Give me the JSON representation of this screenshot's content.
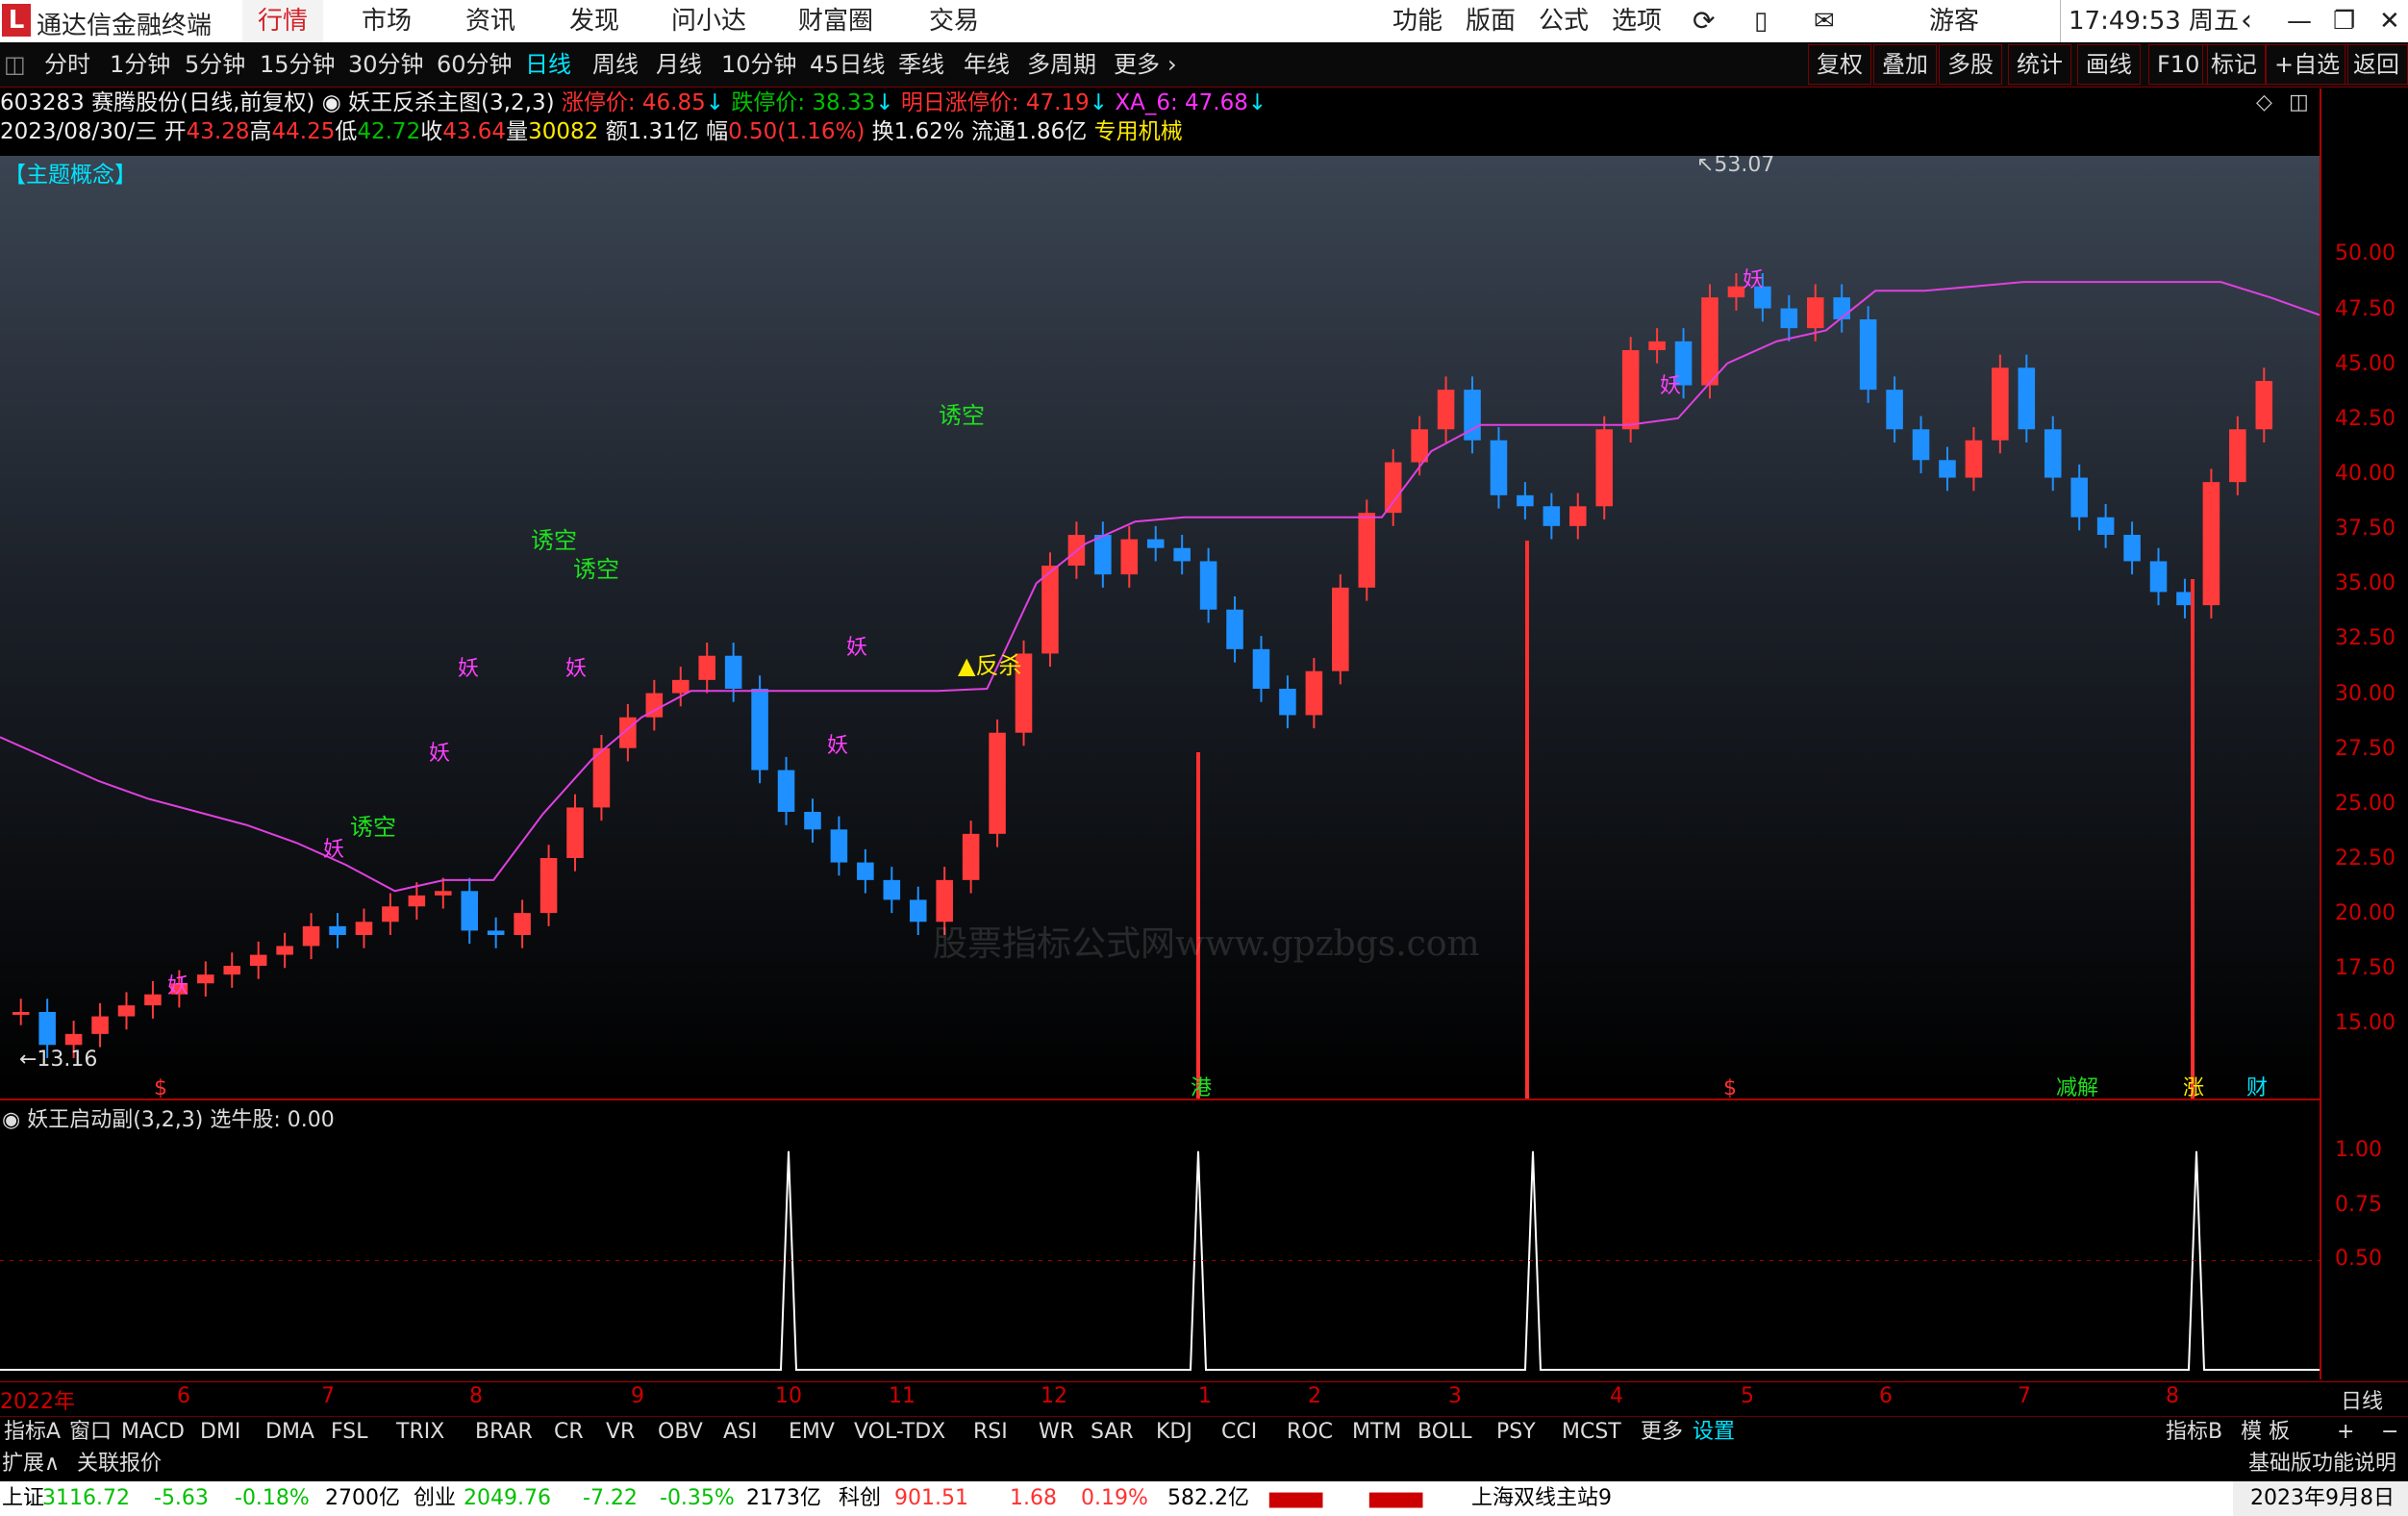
{
  "app": {
    "name": "通达信金融终端",
    "time": "17:49:53 周五",
    "user": "游客"
  },
  "topnav": {
    "items": [
      "行情",
      "市场",
      "资讯",
      "发现",
      "问小达",
      "财富圈",
      "交易"
    ],
    "right": [
      "功能",
      "版面",
      "公式",
      "选项"
    ]
  },
  "periods": {
    "items": [
      "分时",
      "1分钟",
      "5分钟",
      "15分钟",
      "30分钟",
      "60分钟",
      "日线",
      "周线",
      "月线",
      "10分钟",
      "45日线",
      "季线",
      "年线",
      "多周期",
      "更多"
    ],
    "selected": "日线"
  },
  "toolbar_right": [
    "复权",
    "叠加",
    "多股",
    "统计",
    "画线",
    "F10",
    "标记",
    "+自选",
    "返回"
  ],
  "stock": {
    "title": "603283 赛腾股份(日线,前复权)",
    "formula": "妖王反杀主图(3,2,3)",
    "zt": "涨停价: 46.85",
    "dt": "跌停价: 38.33",
    "mzt": "明日涨停价: 47.19",
    "xa": "XA_6: 47.68",
    "date": "2023/08/30/三",
    "open_l": "开",
    "open": "43.28",
    "high_l": "高",
    "high": "44.25",
    "low_l": "低",
    "low": "42.72",
    "close_l": "收",
    "close": "43.64",
    "vol_l": "量",
    "vol": "30082",
    "amt": "额1.31亿",
    "chg_l": "幅",
    "chg": "0.50(1.16%)",
    "turn": "换1.62%",
    "float": "流通1.86亿",
    "industry": "专用机械"
  },
  "chart_labels": {
    "theme": "【主题概念】",
    "max": "53.07",
    "min": "13.16",
    "youkong": "诱空",
    "yao": "妖",
    "fansha": "反杀",
    "watermark": "股票指标公式网www.gpzbgs.com",
    "mark_gang": "港",
    "mark_dollar": "$",
    "mark_jian": "减",
    "mark_jiejin": "解",
    "mark_zhang": "涨",
    "mark_cai": "财"
  },
  "sub_indicator": {
    "name": "妖王启动副(3,2,3)",
    "value": "选牛股: 0.00"
  },
  "chart_data": [
    {
      "type": "candlestick",
      "ylim": [
        12,
        54
      ],
      "y_ticks": [
        "50.00",
        "47.50",
        "45.00",
        "42.50",
        "40.00",
        "37.50",
        "35.00",
        "32.50",
        "30.00",
        "27.50",
        "25.00",
        "22.50",
        "20.00",
        "17.50",
        "15.00"
      ],
      "x_ticks": [
        "2022年",
        "6",
        "7",
        "8",
        "9",
        "10",
        "11",
        "12",
        "1",
        "2",
        "3",
        "4",
        "5",
        "6",
        "7",
        "8"
      ],
      "close": [
        15.5,
        14.0,
        14.5,
        15.3,
        15.8,
        16.3,
        16.8,
        17.2,
        17.6,
        18.1,
        18.5,
        19.4,
        19.0,
        19.6,
        20.3,
        20.8,
        21.0,
        19.2,
        19.0,
        20.0,
        22.5,
        24.8,
        27.5,
        28.9,
        30.0,
        30.6,
        31.7,
        30.2,
        26.5,
        24.6,
        23.8,
        22.3,
        21.5,
        20.6,
        19.6,
        21.5,
        23.6,
        28.2,
        31.8,
        35.8,
        37.2,
        35.4,
        37.0,
        36.6,
        36.0,
        33.8,
        32.0,
        30.2,
        29.0,
        31.0,
        34.8,
        38.2,
        40.5,
        42.0,
        43.8,
        41.5,
        39.0,
        38.5,
        37.6,
        38.5,
        42.0,
        45.6,
        46.0,
        44.0,
        48.0,
        48.5,
        47.5,
        46.6,
        48.0,
        47.0,
        43.8,
        42.0,
        40.6,
        39.8,
        41.5,
        44.8,
        42.0,
        39.8,
        38.0,
        37.2,
        36.0,
        34.6,
        34.0,
        39.6,
        42.0,
        44.2
      ],
      "ma_line": [
        28.0,
        27.0,
        26.0,
        25.2,
        24.6,
        24.0,
        23.2,
        22.2,
        21.0,
        21.5,
        21.5,
        24.5,
        27.0,
        28.9,
        30.1,
        30.1,
        30.1,
        30.1,
        30.1,
        30.1,
        30.2,
        35.0,
        36.8,
        37.8,
        38.0,
        38.0,
        38.0,
        38.0,
        38.0,
        41.0,
        42.2,
        42.2,
        42.2,
        42.2,
        42.5,
        45.0,
        46.0,
        46.5,
        48.3,
        48.3,
        48.5,
        48.7,
        48.7,
        48.7,
        48.7,
        48.7,
        48.0,
        47.2
      ],
      "max": 53.07,
      "min": 13.16
    },
    {
      "type": "line",
      "name": "选牛股",
      "ylim": [
        0,
        1.1
      ],
      "y_ticks": [
        "1.00",
        "0.75",
        "0.50"
      ],
      "spikes_at_months": [
        "10",
        "1",
        "3",
        "8"
      ],
      "values": [
        0,
        1,
        0,
        1,
        0,
        1,
        0,
        1,
        0
      ]
    }
  ],
  "indicator_tabs": {
    "items": [
      "指标A",
      "窗口",
      "MACD",
      "DMI",
      "DMA",
      "FSL",
      "TRIX",
      "BRAR",
      "CR",
      "VR",
      "OBV",
      "ASI",
      "EMV",
      "VOL-TDX",
      "RSI",
      "WR",
      "SAR",
      "KDJ",
      "CCI",
      "ROC",
      "MTM",
      "BOLL",
      "PSY",
      "MCST",
      "更多",
      "设置"
    ],
    "selected": "设置",
    "right": [
      "指标B",
      "模 板",
      "+",
      "−"
    ]
  },
  "ext_bar": {
    "expand": "扩展∧",
    "related": "关联报价",
    "right": "基础版功能说明"
  },
  "status": {
    "sh_name": "上证",
    "sh_val": "3116.72",
    "sh_chg": "-5.63",
    "sh_pct": "-0.18%",
    "sh_amt": "2700亿",
    "cy_name": "创业",
    "cy_val": "2049.76",
    "cy_chg": "-7.22",
    "cy_pct": "-0.35%",
    "cy_amt": "2173亿",
    "kc_name": "科创",
    "kc_val": "901.51",
    "kc_chg": "1.68",
    "kc_pct": "0.19%",
    "kc_amt": "582.2亿",
    "server": "上海双线主站9",
    "date": "2023年9月8日"
  },
  "bottom_right_label": "日线",
  "colors": {
    "up": "#ff3b3b",
    "down": "#1e90ff",
    "ma": "#e040e0",
    "accent": "#d2232a"
  }
}
